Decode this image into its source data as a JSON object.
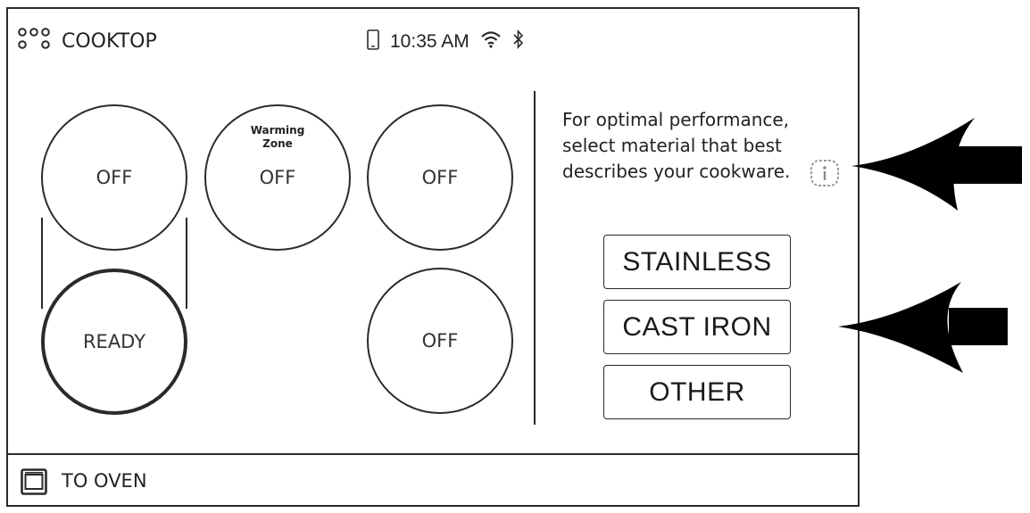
{
  "header": {
    "title": "COOKTOP",
    "time": "10:35 AM",
    "icons": [
      "cooktop-icon",
      "phone-icon",
      "wifi-icon",
      "bluetooth-icon"
    ]
  },
  "burners": {
    "front_left": {
      "state": "OFF"
    },
    "warming_zone": {
      "sub_line1": "Warming",
      "sub_line2": "Zone",
      "state": "OFF"
    },
    "back_right": {
      "state": "OFF"
    },
    "rear_left": {
      "state": "READY"
    },
    "front_right": {
      "state": "OFF"
    }
  },
  "panel": {
    "line1": "For optimal performance,",
    "line2": "select material that best",
    "line3": "describes your cookware.",
    "info_icon": "info-icon"
  },
  "materials": [
    {
      "label": "STAINLESS"
    },
    {
      "label": "CAST IRON"
    },
    {
      "label": "OTHER"
    }
  ],
  "footer": {
    "oven_label": "TO OVEN",
    "oven_icon": "oven-icon"
  },
  "colors": {
    "line": "#2a2a2a",
    "text": "#222222",
    "arrow": "#000000"
  }
}
